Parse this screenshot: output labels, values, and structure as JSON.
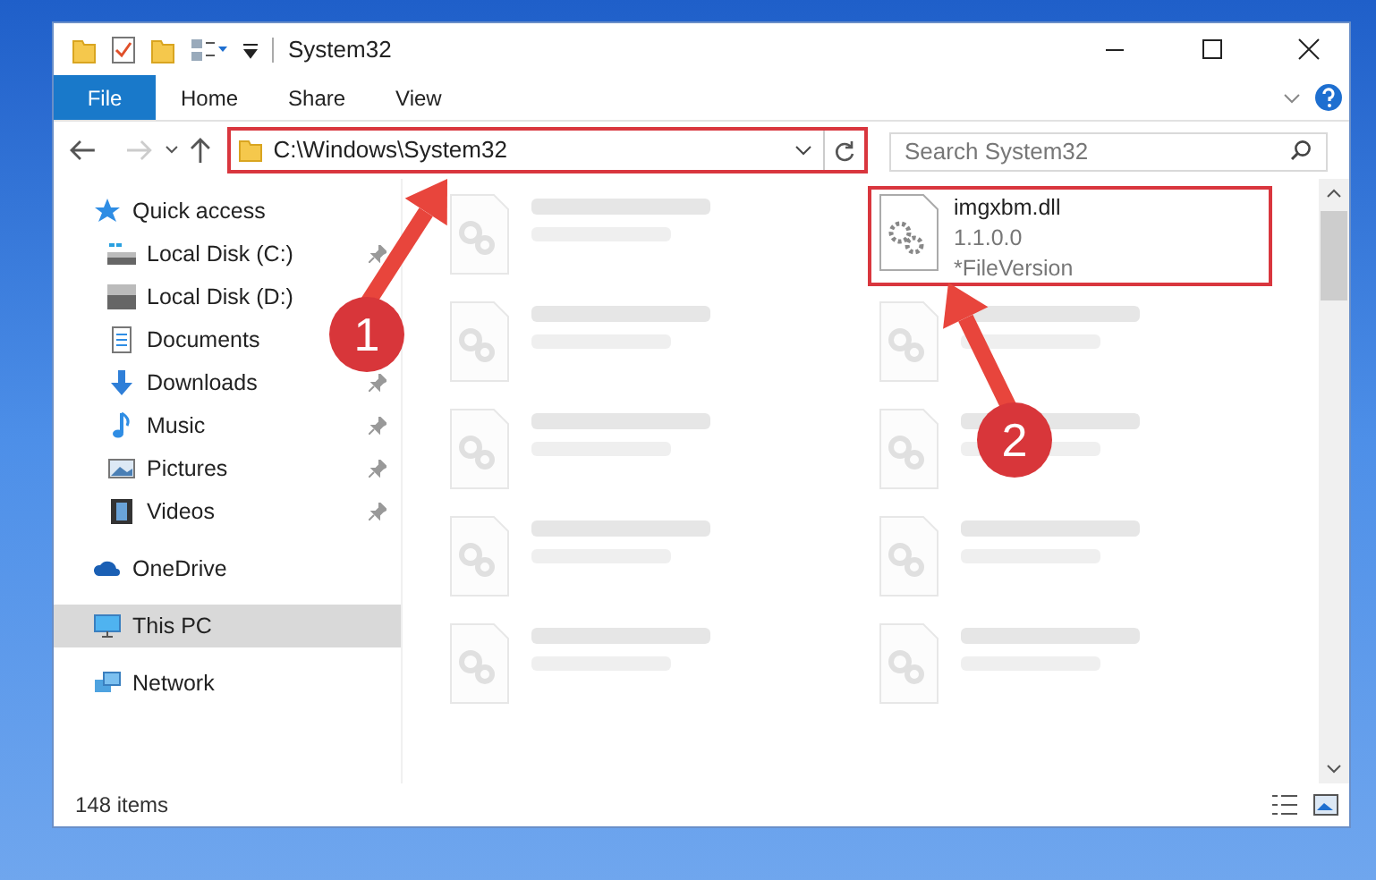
{
  "window": {
    "title": "System32"
  },
  "ribbon_tabs": [
    {
      "label": "File",
      "kind": "menu"
    },
    {
      "label": "Home",
      "kind": "tab"
    },
    {
      "label": "Share",
      "kind": "tab"
    },
    {
      "label": "View",
      "kind": "tab"
    }
  ],
  "address": {
    "path": "C:\\Windows\\System32",
    "highlighted": true
  },
  "search": {
    "placeholder": "Search System32"
  },
  "nav": [
    {
      "label": "Quick access",
      "kind": "star",
      "selected": false,
      "children": [
        {
          "label": "Local Disk (C:)",
          "kind": "drive_c",
          "selected": false,
          "pinned": true
        },
        {
          "label": "Local Disk (D:)",
          "kind": "drive",
          "selected": false
        },
        {
          "label": "Documents",
          "kind": "documents",
          "selected": false
        },
        {
          "label": "Downloads",
          "kind": "downloads",
          "selected": false,
          "pinned": true
        },
        {
          "label": "Music",
          "kind": "music",
          "selected": false,
          "pinned": true
        },
        {
          "label": "Pictures",
          "kind": "pictures",
          "selected": false,
          "pinned": true
        },
        {
          "label": "Videos",
          "kind": "videos",
          "selected": false,
          "pinned": true
        }
      ]
    },
    {
      "label": "OneDrive",
      "kind": "cloud",
      "selected": false
    },
    {
      "label": "This PC",
      "kind": "pc",
      "selected": true
    },
    {
      "label": "Network",
      "kind": "network",
      "selected": false
    }
  ],
  "files": [
    {
      "kind": "blurred"
    },
    {
      "kind": "file",
      "name": "imgxbm.dll",
      "details": [
        "1.1.0.0",
        "*FileVersion"
      ],
      "highlighted": true
    },
    {
      "kind": "blurred"
    },
    {
      "kind": "blurred"
    },
    {
      "kind": "blurred"
    },
    {
      "kind": "blurred"
    },
    {
      "kind": "blurred"
    },
    {
      "kind": "blurred"
    },
    {
      "kind": "blurred"
    },
    {
      "kind": "blurred"
    }
  ],
  "status_bar": {
    "item_count": "148 items"
  },
  "callouts": [
    {
      "label": "1"
    },
    {
      "label": "2"
    }
  ]
}
